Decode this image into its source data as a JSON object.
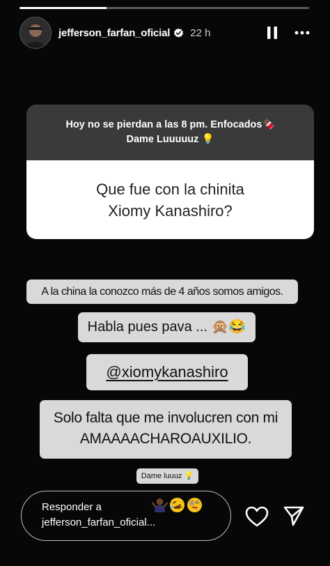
{
  "story": {
    "progress": 0.3
  },
  "header": {
    "username": "jefferson_farfan_oficial",
    "time": "22 h",
    "verified_color": "#ffffff"
  },
  "question_box": {
    "prompt_line1": "Hoy no se pierdan a las 8 pm. Enfocados🍫",
    "prompt_line2": "Dame Luuuuuz 💡",
    "question_line1": "Que fue con la chinita",
    "question_line2": "Xiomy Kanashiro?"
  },
  "captions": {
    "line1": "A la china la conozco más de 4 años somos amigos.",
    "line2": "Habla pues pava ... 🙊😂",
    "mention": "@xiomykanashiro",
    "line4a": "Solo falta que me involucren con mi",
    "line4b": "AMAAAACHAROAUXILIO.",
    "small": "Dame luuuz 💡"
  },
  "reply": {
    "label_line1": "Responder a",
    "label_line2": "jefferson_farfan_oficial...",
    "emojis": [
      "person-shrugging-emoji",
      "rolling-laughing-emoji",
      "zany-face-emoji"
    ]
  },
  "colors": {
    "background": "#070707",
    "question_top": "#3a3a3a",
    "bubble": "#d9d9d9"
  }
}
